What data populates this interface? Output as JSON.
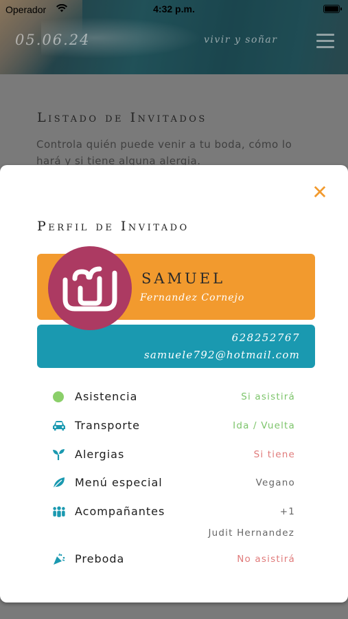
{
  "status_bar": {
    "carrier": "Operador",
    "time": "4:32 p.m."
  },
  "header": {
    "date": "05.06.24",
    "tagline": "vivir y soñar"
  },
  "page": {
    "title": "Listado de Invitados",
    "description": "Controla quién puede venir a tu boda, cómo lo hará y si tiene alguna alergia."
  },
  "modal": {
    "title": "Perfil de Invitado",
    "guest": {
      "name": "SAMUEL",
      "surname": "Fernandez Cornejo",
      "phone": "628252767",
      "email": "samuele792@hotmail.com"
    },
    "details": [
      {
        "label": "Asistencia",
        "value": "Si asistirá",
        "icon": "dot-icon"
      },
      {
        "label": "Transporte",
        "value": "Ida / Vuelta",
        "icon": "car-icon"
      },
      {
        "label": "Alergias",
        "value": "Si tiene",
        "icon": "sprout-icon"
      },
      {
        "label": "Menú especial",
        "value": "Vegano",
        "icon": "leaf-icon"
      },
      {
        "label": "Acompañantes",
        "value": "+1",
        "icon": "people-icon"
      },
      {
        "label": "Preboda",
        "value": "No asistirá",
        "icon": "party-icon"
      }
    ],
    "companion_name": "Judit Hernandez"
  },
  "colors": {
    "accent_orange": "#f29a2e",
    "accent_teal": "#1a99b0",
    "avatar_magenta": "#ac3a62",
    "status_green": "#7cc46a",
    "status_red": "#e07a7a",
    "icon_teal": "#1a99b0",
    "dot_green": "#8bcf6a"
  }
}
